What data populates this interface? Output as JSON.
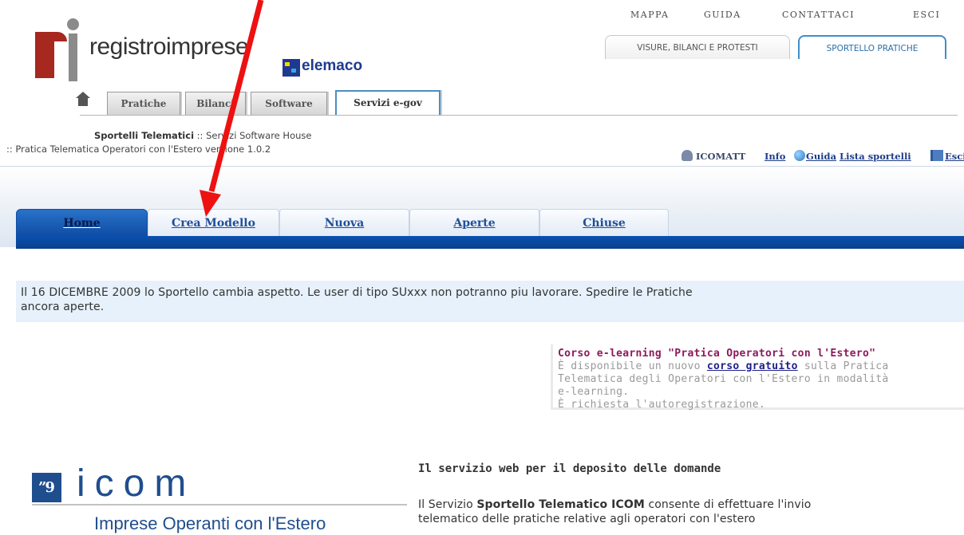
{
  "top_nav": [
    "MAPPA",
    "GUIDA",
    "CONTATTACI",
    "ESCI"
  ],
  "logo": {
    "brand": "registroimprese",
    "telemaco": "elemaco"
  },
  "right_tabs": {
    "visure": "VISURE, BILANCI E PROTESTI",
    "sportello": "SPORTELLO PRATICHE"
  },
  "sub_tabs": [
    "Pratiche",
    "Bilanci",
    "Software",
    "Servizi e-gov"
  ],
  "header": {
    "line1_bold": "Sportelli Telematici",
    "line1_rest": " :: Servizi Software House",
    "line2": ":: Pratica Telematica Operatori con l'Estero versione 1.0.2"
  },
  "user_links": {
    "user": "ICOMATT",
    "info": "Info",
    "guida": "Guida",
    "lista": "Lista sportelli",
    "esci": "Esci"
  },
  "main_tabs": [
    "Home",
    "Crea Modello",
    "Nuova",
    "Aperte",
    "Chiuse"
  ],
  "notice": {
    "line1": "Il 16 DICEMBRE 2009 lo Sportello cambia aspetto. Le user di tipo SUxxx non potranno piu lavorare. Spedire le Pratiche",
    "line2": "ancora aperte."
  },
  "elearning": {
    "title": "Corso e-learning \"Pratica Operatori con l'Estero\"",
    "text_pre": "È disponibile un nuovo ",
    "link": "corso gratuito",
    "text_post": " sulla Pratica",
    "line2": "Telematica degli Operatori con l'Estero in modalità",
    "line3": "e-learning.",
    "line4": "È richiesta l'autoregistrazione."
  },
  "icom": {
    "mark": "”9",
    "name": "icom",
    "subtitle": "Imprese Operanti con l'Estero"
  },
  "service": {
    "title": "Il servizio web per il deposito delle domande",
    "desc_pre": "Il Servizio ",
    "desc_bold": "Sportello Telematico ICOM",
    "desc_post": " consente di effettuare l'invio",
    "desc_line2": "telematico delle pratiche relative agli operatori con l'estero"
  },
  "colors": {
    "arrow": "#ee1111",
    "tab_blue": "#0f4ea6",
    "link_blue": "#1f3d8a",
    "title_purple": "#8e1a5a"
  }
}
